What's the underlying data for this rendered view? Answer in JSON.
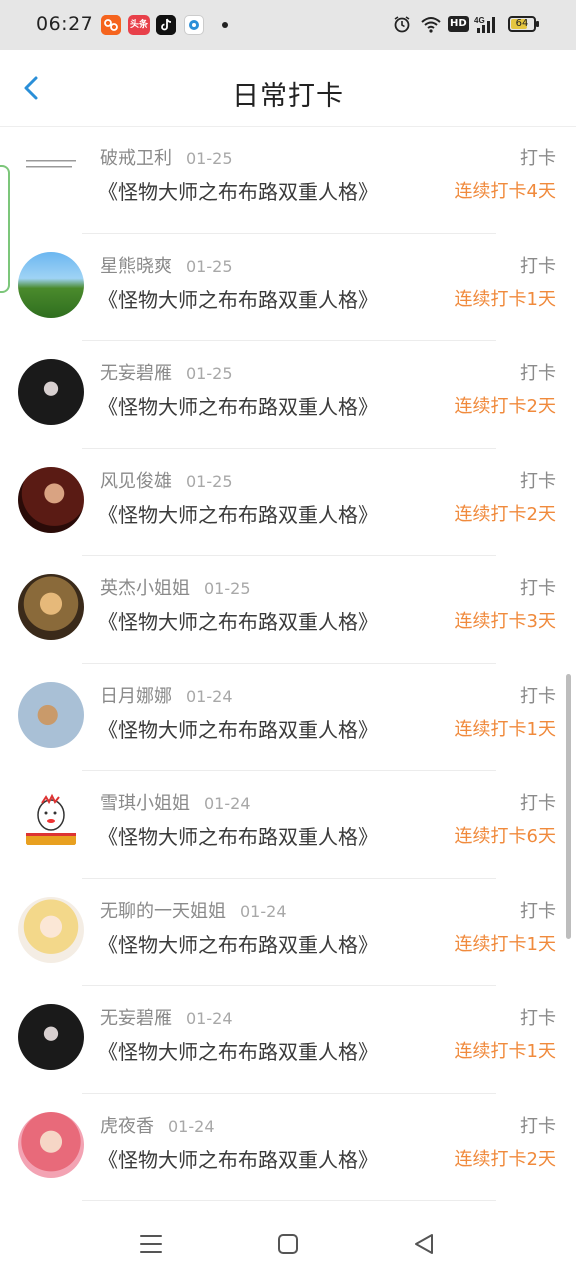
{
  "status_bar": {
    "time": "06:27",
    "app_icons": [
      "taobao-icon",
      "toutiao-icon",
      "tiktok-icon",
      "browser-icon"
    ],
    "toutiao_label": "头条",
    "hd_label": "HD",
    "network_label": "4G",
    "battery_level": "64"
  },
  "header": {
    "title": "日常打卡"
  },
  "colors": {
    "accent_blue": "#2a8fd8",
    "streak_orange": "#f08a3c"
  },
  "checkins": [
    {
      "name": "破戒卫利",
      "date": "01-25",
      "book": "《怪物大师之布布路双重人格》",
      "action": "打卡",
      "streak": "连续打卡4天"
    },
    {
      "name": "星熊晓爽",
      "date": "01-25",
      "book": "《怪物大师之布布路双重人格》",
      "action": "打卡",
      "streak": "连续打卡1天"
    },
    {
      "name": "无妄碧雁",
      "date": "01-25",
      "book": "《怪物大师之布布路双重人格》",
      "action": "打卡",
      "streak": "连续打卡2天"
    },
    {
      "name": "风见俊雄",
      "date": "01-25",
      "book": "《怪物大师之布布路双重人格》",
      "action": "打卡",
      "streak": "连续打卡2天"
    },
    {
      "name": "英杰小姐姐",
      "date": "01-25",
      "book": "《怪物大师之布布路双重人格》",
      "action": "打卡",
      "streak": "连续打卡3天"
    },
    {
      "name": "日月娜娜",
      "date": "01-24",
      "book": "《怪物大师之布布路双重人格》",
      "action": "打卡",
      "streak": "连续打卡1天"
    },
    {
      "name": "雪琪小姐姐",
      "date": "01-24",
      "book": "《怪物大师之布布路双重人格》",
      "action": "打卡",
      "streak": "连续打卡6天"
    },
    {
      "name": "无聊的一天姐姐",
      "date": "01-24",
      "book": "《怪物大师之布布路双重人格》",
      "action": "打卡",
      "streak": "连续打卡1天"
    },
    {
      "name": "无妄碧雁",
      "date": "01-24",
      "book": "《怪物大师之布布路双重人格》",
      "action": "打卡",
      "streak": "连续打卡1天"
    },
    {
      "name": "虎夜香",
      "date": "01-24",
      "book": "《怪物大师之布布路双重人格》",
      "action": "打卡",
      "streak": "连续打卡2天"
    }
  ],
  "nav": {
    "buttons": [
      "menu-icon",
      "home-icon",
      "back-icon"
    ]
  }
}
